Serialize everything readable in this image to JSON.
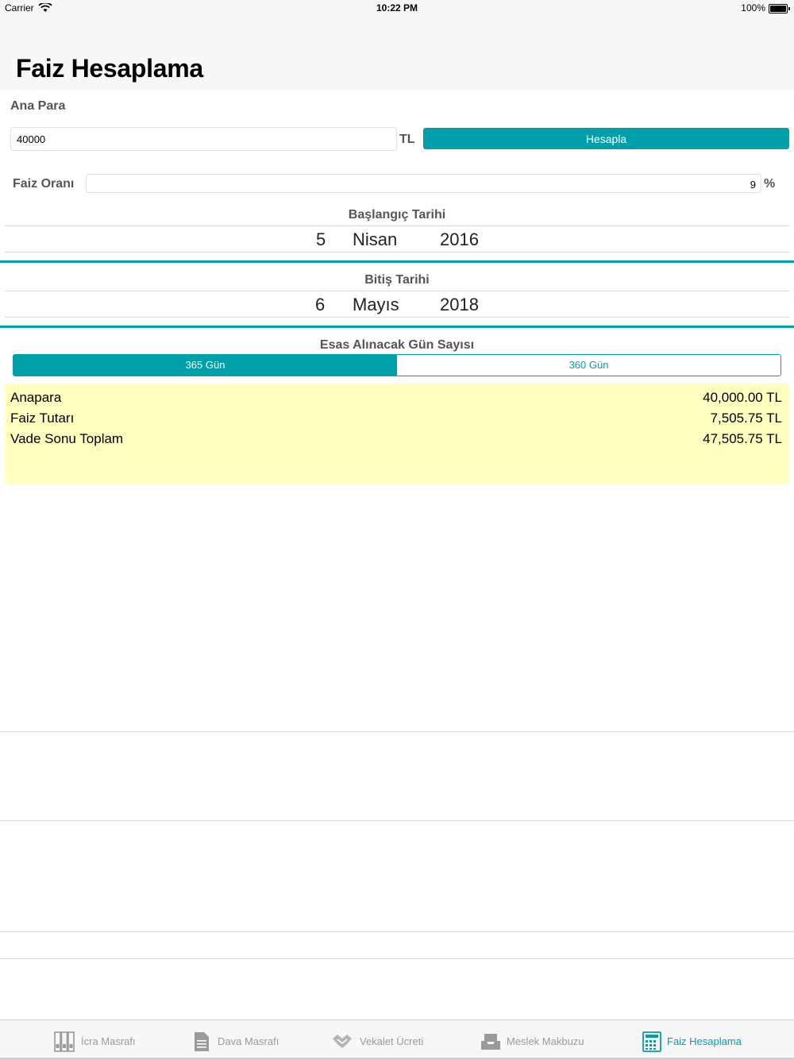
{
  "status_bar": {
    "carrier": "Carrier",
    "time": "10:22 PM",
    "battery": "100%"
  },
  "nav": {
    "title": "Faiz Hesaplama"
  },
  "principal": {
    "label": "Ana Para",
    "value": "40000",
    "unit": "TL",
    "button": "Hesapla"
  },
  "rate": {
    "label": "Faiz Oranı",
    "value": "9",
    "unit": "%"
  },
  "start_date": {
    "title": "Başlangıç Tarihi",
    "day": "5",
    "month": "Nisan",
    "year": "2016"
  },
  "end_date": {
    "title": "Bitiş Tarihi",
    "day": "6",
    "month": "Mayıs",
    "year": "2018"
  },
  "day_basis": {
    "title": "Esas Alınacak Gün Sayısı",
    "options": [
      "365 Gün",
      "360 Gün"
    ],
    "selected": "365 Gün"
  },
  "results": [
    {
      "label": "Anapara",
      "value": "40,000.00 TL"
    },
    {
      "label": "Faiz Tutarı",
      "value": "7,505.75 TL"
    },
    {
      "label": "Vade Sonu Toplam",
      "value": "47,505.75 TL"
    }
  ],
  "tabs": [
    {
      "label": "İcra Masrafı",
      "icon": "binders-icon"
    },
    {
      "label": "Dava Masrafı",
      "icon": "document-icon"
    },
    {
      "label": "Vekalet Ücreti",
      "icon": "handshake-icon"
    },
    {
      "label": "Meslek Makbuzu",
      "icon": "receipt-tray-icon"
    },
    {
      "label": "Faiz Hesaplama",
      "icon": "calculator-icon"
    }
  ],
  "colors": {
    "accent": "#00a0ab",
    "results_bg": "#ffffc0",
    "bar_bg": "#f7f7f7"
  }
}
